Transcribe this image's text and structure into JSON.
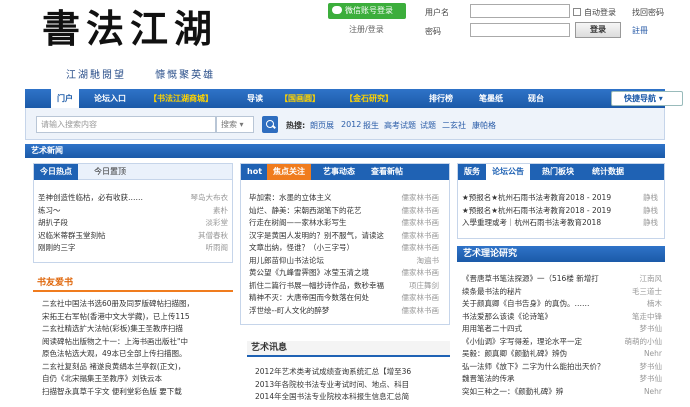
{
  "header": {
    "logo_text": "書法江湖",
    "slogan": [
      "江湖馳閱望",
      "慷慨聚英雄"
    ],
    "wechat_login": "微信账号登录",
    "register_login": "注册/登录",
    "username_label": "用户名",
    "password_label": "密码",
    "auto_login": "自动登录",
    "forgot_password": "找回密码",
    "login_button": "登录",
    "register": "註冊"
  },
  "nav": {
    "items": [
      "门户",
      "论坛入口",
      "【书法江湖商城】",
      "导读",
      "【国画圆】",
      "【金石研究】",
      "排行榜",
      "笔墨纸",
      "砚台"
    ],
    "quick_nav": "快捷导航"
  },
  "search": {
    "placeholder": "请输入搜索内容",
    "type": "搜索",
    "hot_label": "热搜:",
    "hot_keywords": [
      "朗页展",
      "2012",
      "报生",
      "高考试题",
      "试题",
      "二玄社",
      "康帕格"
    ]
  },
  "art_news": {
    "title": "艺术新闻",
    "tabs": [
      "今日热点",
      "今日置顶"
    ],
    "items": [
      {
        "title": "圣神创造性临枯，必有收获……",
        "source": "琴岛大布衣"
      },
      {
        "title": "练习～",
        "source": "素朴"
      },
      {
        "title": "胡扒子段",
        "source": "淡彩堂"
      },
      {
        "title": "迟临米蒂群玉堂刻帖",
        "source": "其僧春秋"
      },
      {
        "title": "刚刚的三字",
        "source": "听雨阁"
      }
    ]
  },
  "center": {
    "tabs": [
      "hot",
      "焦点关注",
      "艺事动态",
      "查看新帖"
    ],
    "items": [
      {
        "title": "毕加索：水墨的立体主义",
        "source": "儒家林书画"
      },
      {
        "title": "灿烂、静美：宋朝西湖笔下的花艺",
        "source": "儒家林书画"
      },
      {
        "title": "行走在树阁——家林水彩写生",
        "source": "儒家林书画"
      },
      {
        "title": "汉字是黄国人发明的？别不服气，请读这",
        "source": "儒家林书画"
      },
      {
        "title": "文章出纳，怪谁？（小三字号）",
        "source": "儒家林书画"
      },
      {
        "title": "用儿郎苗仰山书法论坛",
        "source": "淘遍书"
      },
      {
        "title": "黄公望《九峰雪霁图》冰莹玉清之境",
        "source": "儒家林书画"
      },
      {
        "title": "抓住二篇行书展一幅抄诗作品，数秒幸福",
        "source": "项庄舞剑"
      },
      {
        "title": "精神不灭：大唐帝国而今数落在何处",
        "source": "儒家林书画"
      },
      {
        "title": "浮世绘--町人文化的醉梦",
        "source": "儒家林书画"
      }
    ]
  },
  "forum": {
    "tabs": [
      "版务",
      "论坛公告",
      "热门板块",
      "统计数据"
    ],
    "items": [
      {
        "title": "★预报名★杭州石雨书法考教育2018 - 2019",
        "source": "静栈"
      },
      {
        "title": "★预报名★杭州石雨书法考教育2018 - 2019",
        "source": "静栈"
      },
      {
        "title": "入學重理或考｜杭州石雨书法考教育2018",
        "source": "静栈"
      }
    ]
  },
  "book_lovers": {
    "title": "书友爱书",
    "items": [
      "二玄社中国法书选60册及同罗版碑帖扫描图，",
      "宋拓王右军帖(香港中文大学藏)，已上传115",
      "二玄社精选扩大法帖(彩板)集王圣教序扫描",
      "阅读碑帖出版物之十一：上海书画出版社\"中",
      "原色法帖选大观，49本已全部上传扫描图。",
      "二玄社复刻品 褚遂良黄绢本兰亭叙(正文)，",
      "自仍《北宋搨集王圣教序》刘铁云本",
      "扫描智永真草千字文 便利堂彩色版 要下载"
    ]
  },
  "art_news2": {
    "title": "艺术讯息",
    "items": [
      "2012年艺术类考试成绩查询系统汇总【增至36",
      "2013年各院校书法专业考试时间、地点、科目",
      "2014年全国书法专业院校本科报生信息汇总简"
    ]
  },
  "theory": {
    "title": "艺术理论研究",
    "items": [
      {
        "title": "《晋唐草书笔法探源》一（516楼 新增打",
        "source": "江南风"
      },
      {
        "title": "续条最书法的秘片",
        "source": "毛三道士"
      },
      {
        "title": "关于颜真卿《自书告身》的真伪。……",
        "source": "楠木"
      },
      {
        "title": "书法爱那么该读《论诗笔》",
        "source": "笔走中锋"
      },
      {
        "title": "用用笔者二十四式",
        "source": "梦书仙"
      },
      {
        "title": "《小仙调》字写得差，理论水平一定",
        "source": "萌萌的小仙"
      },
      {
        "title": "吴毅：颜真卿《颜勤礼碑》辨伪",
        "source": "Nehr"
      },
      {
        "title": "弘一法师《放下》二字为什么能拍出天价？",
        "source": "梦书仙"
      },
      {
        "title": "魏晋笔法的传承",
        "source": "梦书仙"
      },
      {
        "title": "突如三种之一：《颜勤礼碑》辨",
        "source": "Nehr"
      }
    ]
  }
}
